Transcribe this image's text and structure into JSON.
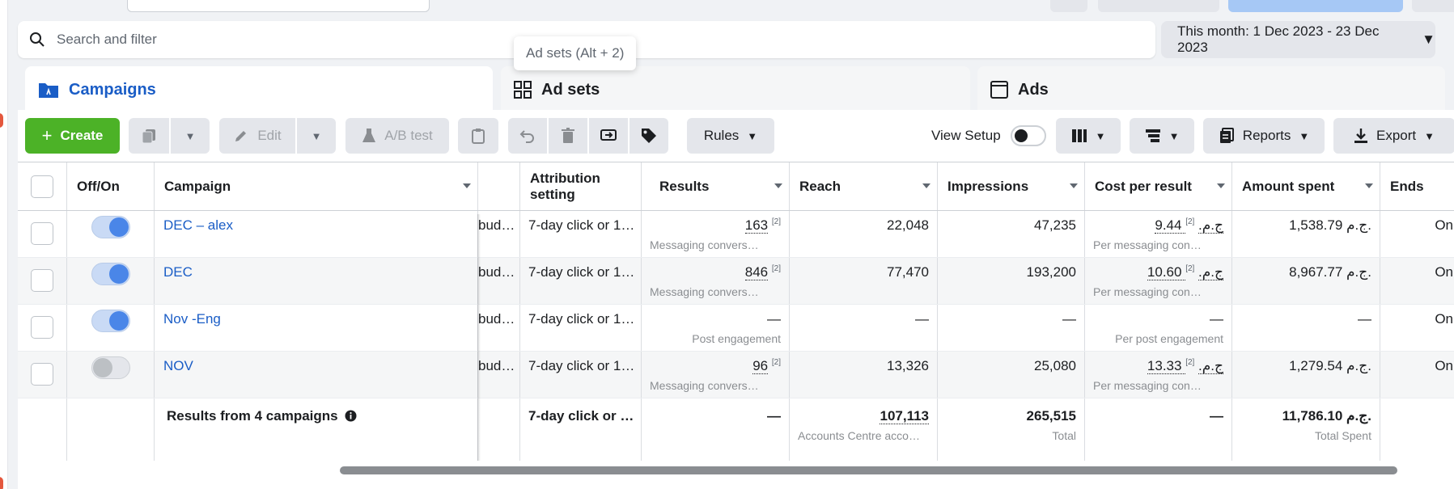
{
  "search": {
    "placeholder": "Search and filter"
  },
  "date_range": {
    "label": "This month: 1 Dec 2023 - 23 Dec 2023"
  },
  "tooltip": {
    "text": "Ad sets (Alt + 2)"
  },
  "tabs": [
    {
      "label": "Campaigns",
      "active": true
    },
    {
      "label": "Ad sets",
      "active": false
    },
    {
      "label": "Ads",
      "active": false
    }
  ],
  "toolbar": {
    "create": "Create",
    "edit": "Edit",
    "ab_test": "A/B test",
    "rules": "Rules",
    "view_setup": "View Setup",
    "reports": "Reports",
    "export": "Export"
  },
  "columns": {
    "off_on": "Off/On",
    "campaign": "Campaign",
    "attribution": "Attribution setting",
    "results": "Results",
    "reach": "Reach",
    "impressions": "Impressions",
    "cost_per_result": "Cost per result",
    "amount_spent": "Amount spent",
    "ends": "Ends"
  },
  "rows": [
    {
      "name": "DEC – alex",
      "on": true,
      "budget": "bud…",
      "attribution": "7-day click or 1…",
      "results": "163",
      "results_fn": "[2]",
      "results_sub": "Messaging convers…",
      "reach": "22,048",
      "impressions": "47,235",
      "cpr": "9.44 ج.م.",
      "cpr_fn": "[2]",
      "cpr_sub": "Per messaging con…",
      "spent": "1,538.79 ج.م.",
      "ends": "On"
    },
    {
      "name": "DEC",
      "on": true,
      "budget": "bud…",
      "attribution": "7-day click or 1…",
      "results": "846",
      "results_fn": "[2]",
      "results_sub": "Messaging convers…",
      "reach": "77,470",
      "impressions": "193,200",
      "cpr": "10.60 ج.م.",
      "cpr_fn": "[2]",
      "cpr_sub": "Per messaging con…",
      "spent": "8,967.77 ج.م.",
      "ends": "On"
    },
    {
      "name": "Nov -Eng",
      "on": true,
      "budget": "bud…",
      "attribution": "7-day click or 1…",
      "results": "—",
      "results_fn": "",
      "results_sub": "Post engagement",
      "reach": "—",
      "impressions": "—",
      "cpr": "—",
      "cpr_fn": "",
      "cpr_sub": "Per post engagement",
      "spent": "—",
      "ends": "On"
    },
    {
      "name": "NOV",
      "on": false,
      "budget": "bud…",
      "attribution": "7-day click or 1…",
      "results": "96",
      "results_fn": "[2]",
      "results_sub": "Messaging convers…",
      "reach": "13,326",
      "impressions": "25,080",
      "cpr": "13.33 ج.م.",
      "cpr_fn": "[2]",
      "cpr_sub": "Per messaging con…",
      "spent": "1,279.54 ج.م.",
      "ends": "On"
    }
  ],
  "totals": {
    "label": "Results from 4 campaigns",
    "attribution": "7-day click or …",
    "results": "—",
    "reach": "107,113",
    "reach_sub": "Accounts Centre acco…",
    "impressions": "265,515",
    "impressions_sub": "Total",
    "cpr": "—",
    "spent": "11,786.10 ج.م.",
    "spent_sub": "Total Spent"
  },
  "colors": {
    "accent": "#1a5dc6",
    "create": "#4cb227",
    "toggle_on": "#4a86e8"
  }
}
